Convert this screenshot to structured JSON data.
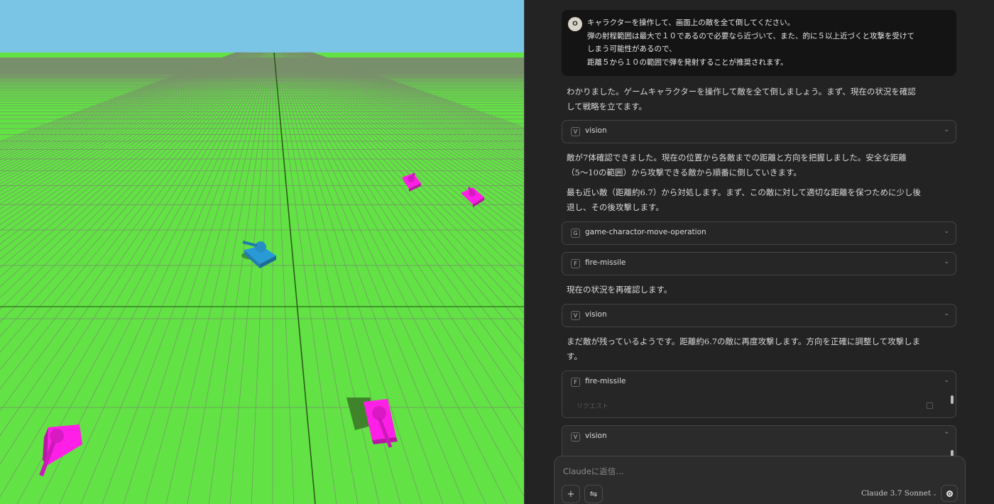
{
  "game": {
    "sky_color": "#7ac4e6",
    "ground_color": "#62e245",
    "player_tank_color": "#2a9ad6",
    "enemy_tank_color": "#ff1fe6"
  },
  "chat": {
    "user_avatar_letter": "O",
    "user_message_lines": [
      "キャラクターを操作して、画面上の敵を全て倒してください。",
      "弾の射程範囲は最大で１０であるので必要なら近づいて、また、的に５以上近づくと攻撃を受けて",
      "しまう可能性があるので、",
      "距離５から１０の範囲で弾を発射することが推奨されます。"
    ],
    "para1": [
      "わかりました。ゲームキャラクターを操作して敵を全て倒しましょう。まず、現在の状況を確認",
      "して戦略を立てます。"
    ],
    "tool1": {
      "badge": "V",
      "label": "vision"
    },
    "para2": [
      "敵が7体確認できました。現在の位置から各敵までの距離と方向を把握しました。安全な距離",
      "（5〜10の範囲）から攻撃できる敵から順番に倒していきます。"
    ],
    "para3": [
      "最も近い敵（距離約6.7）から対処します。まず、この敵に対して適切な距離を保つために少し後",
      "退し、その後攻撃します。"
    ],
    "tool2": {
      "badge": "G",
      "label": "game-charactor-move-operation"
    },
    "tool3": {
      "badge": "F",
      "label": "fire-missile"
    },
    "para4": [
      "現在の状況を再確認します。"
    ],
    "tool4": {
      "badge": "V",
      "label": "vision"
    },
    "para5": [
      "まだ敵が残っているようです。距離約6.7の敵に再度攻撃します。方向を正確に調整して攻撃しま",
      "す。"
    ],
    "tool5": {
      "badge": "F",
      "label": "fire-missile",
      "sub_label": "リクエスト"
    },
    "tool6": {
      "badge": "V",
      "label": "vision"
    },
    "chevron_down": "⌄",
    "chevron_up": "⌃",
    "composer": {
      "placeholder": "Claudeに返信...",
      "add_icon": "+",
      "tools_icon": "⇋",
      "model_label": "Claude 3.7 Sonnet",
      "model_dropdown": "⌄"
    }
  }
}
